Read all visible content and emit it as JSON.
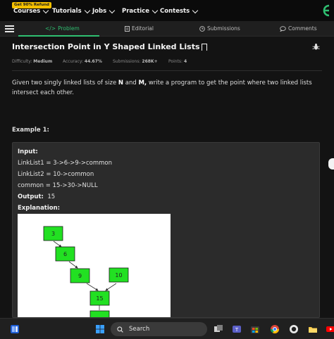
{
  "nav": {
    "promo_badge": "Get 90% Refund",
    "items": [
      {
        "label": "Courses"
      },
      {
        "label": "Tutorials"
      },
      {
        "label": "Jobs"
      },
      {
        "label": "Practice"
      },
      {
        "label": "Contests"
      }
    ],
    "brand_color": "#2fbf71"
  },
  "tabs": [
    {
      "label": "Problem",
      "icon": "code-icon",
      "active": true
    },
    {
      "label": "Editorial",
      "icon": "document-icon",
      "active": false
    },
    {
      "label": "Submissions",
      "icon": "clock-icon",
      "active": false
    },
    {
      "label": "Comments",
      "icon": "comment-icon",
      "active": false
    }
  ],
  "problem": {
    "title": "Intersection Point in Y Shaped Linked Lists",
    "difficulty_label": "Difficulty:",
    "difficulty": "Medium",
    "accuracy_label": "Accuracy:",
    "accuracy": "44.67%",
    "submissions_label": "Submissions:",
    "submissions": "268K+",
    "points_label": "Points:",
    "points": "4",
    "desc_a": "Given two singly linked lists of size ",
    "desc_n": "N",
    "desc_and": " and ",
    "desc_m": "M,",
    "desc_b": " write a program to get the point where two linked lists intersect each other."
  },
  "example": {
    "heading": "Example 1:",
    "input_label": "Input:",
    "linklist1": "LinkList1  =  3->6->9->common",
    "linklist2": "LinkList2  =  10->common",
    "common": "common  =  15->30->NULL",
    "output_label": "Output:",
    "output_value": "15",
    "explanation_label": "Explanation:",
    "nodes": [
      "3",
      "6",
      "9",
      "10",
      "15"
    ]
  },
  "taskbar": {
    "search_label": "Search"
  }
}
